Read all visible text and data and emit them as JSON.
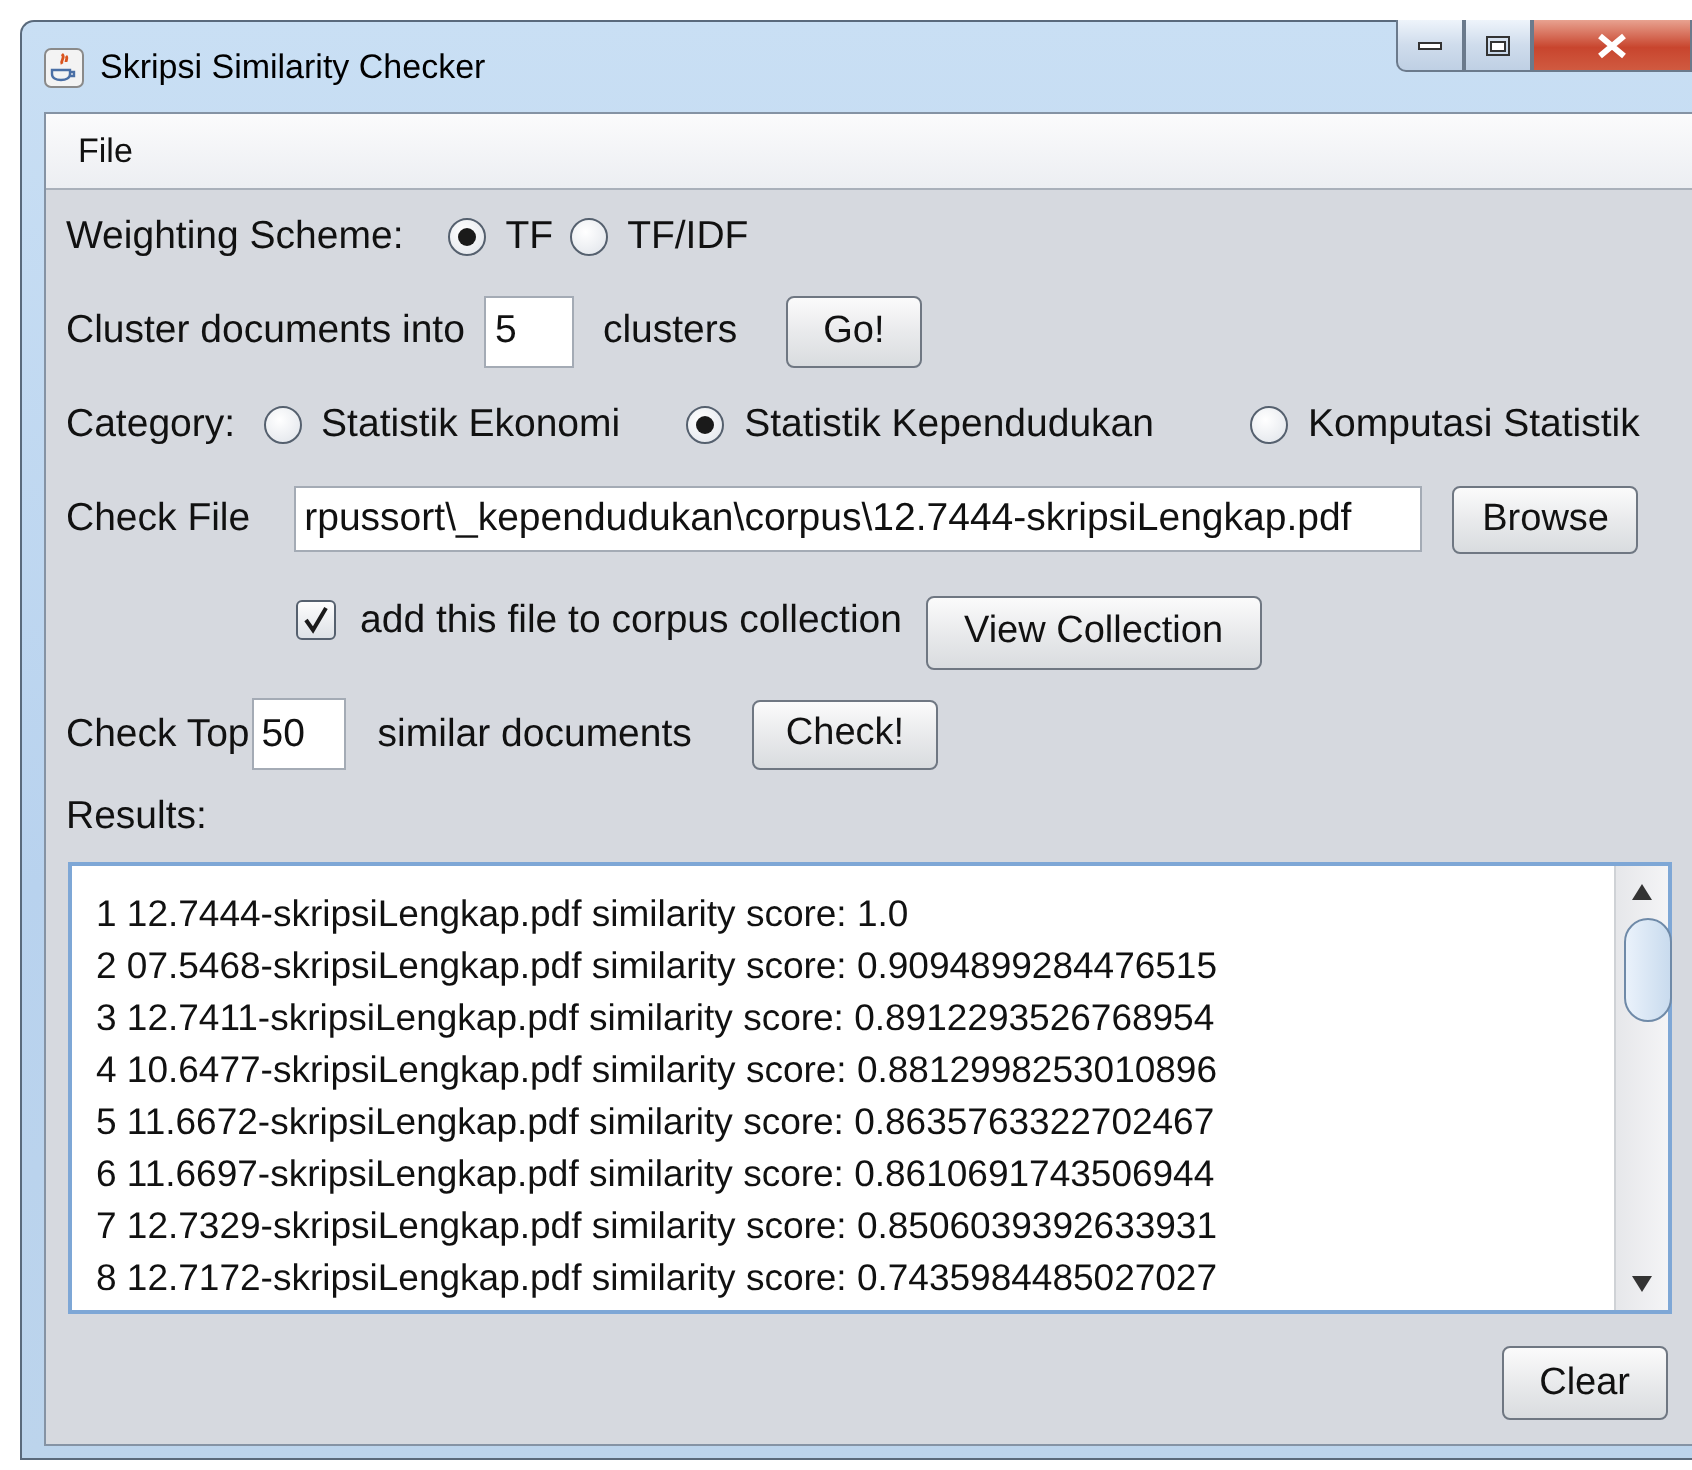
{
  "window": {
    "title": "Skripsi Similarity Checker"
  },
  "menu": [
    {
      "label": "File"
    }
  ],
  "weighting": {
    "label": "Weighting Scheme:",
    "options": [
      {
        "label": "TF",
        "selected": true
      },
      {
        "label": "TF/IDF",
        "selected": false
      }
    ]
  },
  "cluster": {
    "label": "Cluster documents into",
    "value": "5",
    "suffix": "clusters",
    "button": "Go!"
  },
  "category": {
    "label": "Category:",
    "options": [
      {
        "label": "Statistik Ekonomi",
        "selected": false
      },
      {
        "label": "Statistik Kependudukan",
        "selected": true
      },
      {
        "label": "Komputasi Statistik",
        "selected": false
      }
    ]
  },
  "check_file": {
    "label": "Check File",
    "value": "rpussort\\_kependudukan\\corpus\\12.7444-skripsiLengkap.pdf",
    "button": "Browse"
  },
  "add_to_corpus": {
    "label": "add this file to corpus collection",
    "checked": true,
    "button": "View Collection"
  },
  "check_top": {
    "label": "Check Top",
    "value": "50",
    "suffix": "similar documents",
    "button": "Check!"
  },
  "results": {
    "label": "Results:",
    "lines": [
      "1 12.7444-skripsiLengkap.pdf similarity score: 1.0",
      "2 07.5468-skripsiLengkap.pdf similarity score: 0.9094899284476515",
      "3 12.7411-skripsiLengkap.pdf similarity score: 0.8912293526768954",
      "4 10.6477-skripsiLengkap.pdf similarity score: 0.8812998253010896",
      "5 11.6672-skripsiLengkap.pdf similarity score: 0.8635763322702467",
      "6 11.6697-skripsiLengkap.pdf similarity score: 0.8610691743506944",
      "7 12.7329-skripsiLengkap.pdf similarity score: 0.8506039392633931",
      "8 12.7172-skripsiLengkap.pdf similarity score: 0.7435984485027027"
    ]
  },
  "clear_button": "Clear"
}
